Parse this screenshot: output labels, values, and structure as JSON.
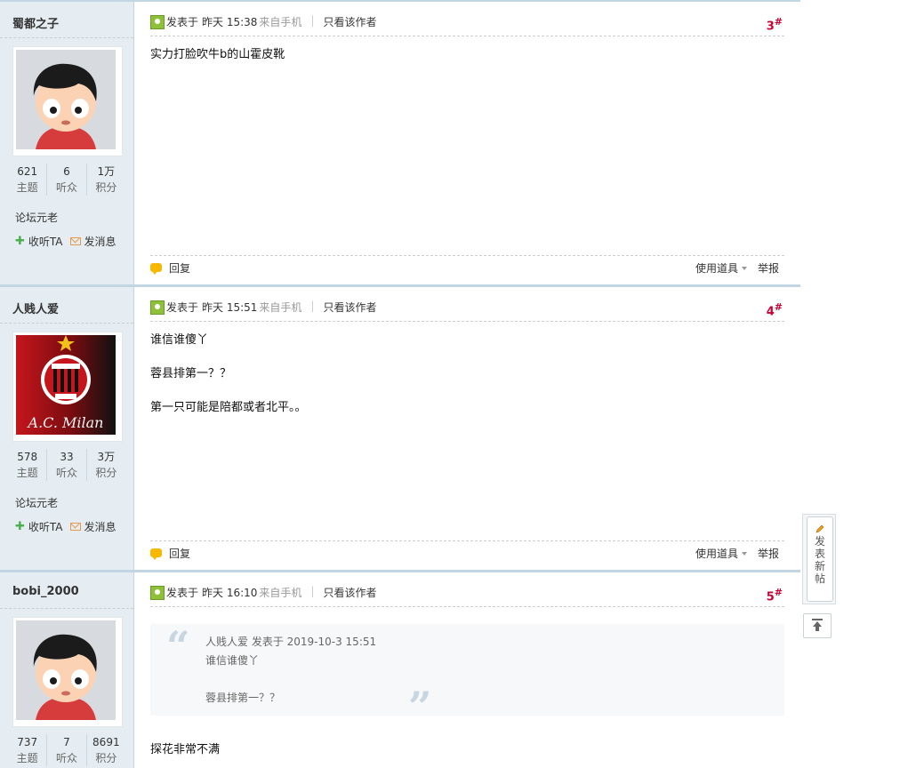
{
  "posts": [
    {
      "username": "蜀都之子",
      "avatar": "default-cartoon",
      "stats": [
        {
          "num": "621",
          "label": "主题"
        },
        {
          "num": "6",
          "label": "听众"
        },
        {
          "num": "1万",
          "label": "积分"
        }
      ],
      "level": "论坛元老",
      "follow_label": "收听TA",
      "message_label": "发消息",
      "posted_label": "发表于",
      "posted_time": "昨天 15:38",
      "device": "来自手机",
      "only_author": "只看该作者",
      "floor": "3",
      "floor_mark": "#",
      "body": [
        "实力打脸吹牛b的山霍皮靴"
      ],
      "reply_label": "回复",
      "tools_label": "使用道具",
      "report_label": "举报"
    },
    {
      "username": "人贱人爱",
      "avatar": "ac-milan",
      "avatar_text": "A.C. Milan",
      "stats": [
        {
          "num": "578",
          "label": "主题"
        },
        {
          "num": "33",
          "label": "听众"
        },
        {
          "num": "3万",
          "label": "积分"
        }
      ],
      "level": "论坛元老",
      "follow_label": "收听TA",
      "message_label": "发消息",
      "posted_label": "发表于",
      "posted_time": "昨天 15:51",
      "device": "来自手机",
      "only_author": "只看该作者",
      "floor": "4",
      "floor_mark": "#",
      "body": [
        "谁信谁傻丫",
        "蓉县排第一？？",
        "第一只可能是陪都或者北平。。"
      ],
      "reply_label": "回复",
      "tools_label": "使用道具",
      "report_label": "举报"
    },
    {
      "username": "bobi_2000",
      "avatar": "default-cartoon",
      "stats": [
        {
          "num": "737",
          "label": "主题"
        },
        {
          "num": "7",
          "label": "听众"
        },
        {
          "num": "8691",
          "label": "积分"
        }
      ],
      "posted_label": "发表于",
      "posted_time": "昨天 16:10",
      "device": "来自手机",
      "only_author": "只看该作者",
      "floor": "5",
      "floor_mark": "#",
      "quote": {
        "header": "人贱人爱 发表于 2019-10-3 15:51",
        "line1": "谁信谁傻丫",
        "line2": "蓉县排第一？？"
      },
      "body": [
        "探花非常不满"
      ]
    }
  ],
  "float": {
    "new_post": "发表新帖"
  },
  "icons": {
    "post_icon": "user-post-icon",
    "reply_icon": "speech-bubble-icon",
    "follow_icon": "plus-icon",
    "message_icon": "envelope-icon",
    "top_icon": "back-to-top-icon",
    "new_post_icon": "pencil-icon"
  },
  "colors": {
    "floor_number": "#cc0033",
    "author_bg": "#e5edf2",
    "border": "#c2d5e3"
  }
}
